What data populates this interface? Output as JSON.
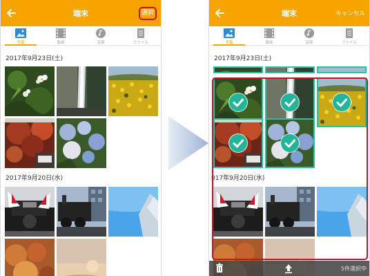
{
  "colors": {
    "accent": "#f7a400",
    "highlight": "#c8102e",
    "selected": "#22b59a"
  },
  "left": {
    "title": "端末",
    "action": "選択",
    "tabs": [
      {
        "label": "写真",
        "icon": "photo-icon"
      },
      {
        "label": "動画",
        "icon": "video-icon"
      },
      {
        "label": "音楽",
        "icon": "music-icon"
      },
      {
        "label": "ファイル",
        "icon": "file-icon"
      }
    ],
    "date1": "2017年9月23日(土)",
    "date2": "2017年9月20日(水)"
  },
  "right": {
    "title": "端末",
    "action": "キャンセル",
    "tabs": [
      {
        "label": "写真",
        "icon": "photo-icon"
      },
      {
        "label": "動画",
        "icon": "video-icon"
      },
      {
        "label": "音楽",
        "icon": "music-icon"
      },
      {
        "label": "ファイル",
        "icon": "file-icon"
      }
    ],
    "date1": "2017年9月23日(土)",
    "date2": "017年9月20日(水)",
    "selected_count": "5件選択中"
  }
}
